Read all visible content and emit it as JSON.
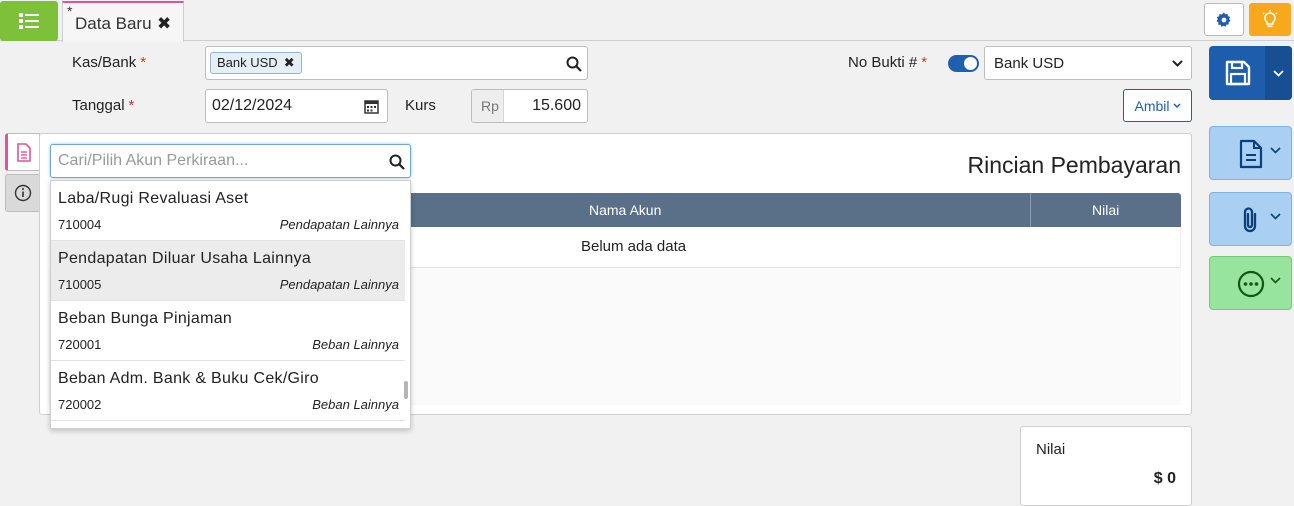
{
  "tab": {
    "modified_marker": "*",
    "title": "Data Baru",
    "close_glyph": "✖"
  },
  "form": {
    "kas_bank": {
      "label": "Kas/Bank",
      "required_marker": "*",
      "chip": "Bank USD",
      "chip_remove": "✖"
    },
    "tanggal": {
      "label": "Tanggal",
      "required_marker": "*",
      "value": "02/12/2024"
    },
    "kurs": {
      "label": "Kurs",
      "currency": "Rp",
      "value": "15.600"
    },
    "no_bukti": {
      "label": "No Bukti #",
      "required_marker": "*",
      "toggle_on": true,
      "selected": "Bank USD"
    },
    "ambil_label": "Ambil"
  },
  "panel": {
    "title": "Rincian Pembayaran",
    "columns": [
      "Nama Akun",
      "Nilai"
    ],
    "empty_text": "Belum ada data"
  },
  "account_search": {
    "placeholder": "Cari/Pilih Akun Perkiraan...",
    "options": [
      {
        "name": "Laba/Rugi Revaluasi Aset",
        "code": "710004",
        "category": "Pendapatan Lainnya",
        "highlighted": false
      },
      {
        "name": "Pendapatan Diluar Usaha Lainnya",
        "code": "710005",
        "category": "Pendapatan Lainnya",
        "highlighted": true
      },
      {
        "name": "Beban Bunga Pinjaman",
        "code": "720001",
        "category": "Beban Lainnya",
        "highlighted": false
      },
      {
        "name": "Beban Adm. Bank & Buku Cek/Giro",
        "code": "720002",
        "category": "Beban Lainnya",
        "highlighted": false
      }
    ]
  },
  "summary": {
    "label": "Nilai",
    "value": "$ 0"
  },
  "icons": {
    "menu": "list-icon",
    "settings": "gear-icon",
    "tips": "lightbulb-icon",
    "save": "save-icon",
    "document": "document-icon",
    "attachment": "paperclip-icon",
    "more": "more-icon",
    "calendar": "calendar-icon",
    "search": "search-icon",
    "info": "info-icon"
  },
  "colors": {
    "menu_green": "#7dc13a",
    "tab_accent": "#e0559a",
    "primary_blue": "#1d5dab",
    "light_blue": "#a9cff3",
    "light_green": "#98e39d",
    "table_header": "#5a6f88",
    "tips_orange": "#f7a81b",
    "required_red": "#d9302c"
  }
}
